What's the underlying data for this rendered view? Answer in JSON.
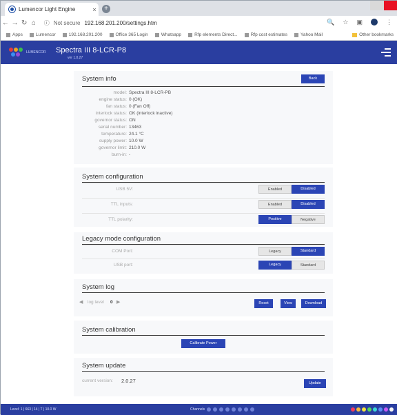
{
  "browser": {
    "tab_title": "Lumencor Light Engine",
    "tab_close": "×",
    "new_tab": "+",
    "address": {
      "security": "Not secure",
      "url": "192.168.201.200/settings.htm"
    },
    "bookmarks": [
      "Apps",
      "Lumencor",
      "192.168.201.200",
      "Office 365 Login",
      "Whatsapp",
      "Rfp elements Direct...",
      "Rfp cost estimates",
      "Yahoo Mail"
    ],
    "other_bookmarks": "Other bookmarks"
  },
  "header": {
    "brand": "LUMENCOR",
    "title": "Spectra III 8-LCR-P8",
    "version": "ver 1.0.27"
  },
  "system_info": {
    "title": "System info",
    "back_button": "Back",
    "rows": [
      {
        "label": "model:",
        "value": "Spectra III 8-LCR-PB"
      },
      {
        "label": "engine status:",
        "value": "0 (OK)"
      },
      {
        "label": "fan status:",
        "value": "0 (Fan Off)"
      },
      {
        "label": "interlock status:",
        "value": "OK (interlock inactive)"
      },
      {
        "label": "governor status:",
        "value": "ON"
      },
      {
        "label": "serial number:",
        "value": "13463"
      },
      {
        "label": "temperature:",
        "value": "24.1 °C"
      },
      {
        "label": "supply power:",
        "value": "10.0 W"
      },
      {
        "label": "governor limit:",
        "value": "210.0 W"
      },
      {
        "label": "burn-in:",
        "value": "-"
      }
    ]
  },
  "system_configuration": {
    "title": "System configuration",
    "rows": [
      {
        "label": "USB 5V:",
        "left": "Enabled",
        "right": "Disabled",
        "selected": "right"
      },
      {
        "label": "TTL inputs:",
        "left": "Enabled",
        "right": "Disabled",
        "selected": "right"
      },
      {
        "label": "TTL polarity:",
        "left": "Positive",
        "right": "Negative",
        "selected": "left"
      }
    ]
  },
  "legacy_mode": {
    "title": "Legacy mode configuration",
    "rows": [
      {
        "label": "COM Port:",
        "left": "Legacy",
        "right": "Standard",
        "selected": "right"
      },
      {
        "label": "USB port:",
        "left": "Legacy",
        "right": "Standard",
        "selected": "left"
      }
    ]
  },
  "system_log": {
    "title": "System log",
    "log_level_label": "log level",
    "log_level_value": "0",
    "reset_button": "Reset",
    "view_button": "View",
    "download_button": "Download"
  },
  "system_calibration": {
    "title": "System calibration",
    "calibrate_button": "Calibrate Power"
  },
  "system_update": {
    "title": "System update",
    "current_version_label": "current version:",
    "current_version_value": "2.0.27",
    "update_button": "Update"
  },
  "footer": {
    "status_text": "Level: 1 | 663 | 14 | T | 10.0 W",
    "channels_label": "Channels"
  }
}
